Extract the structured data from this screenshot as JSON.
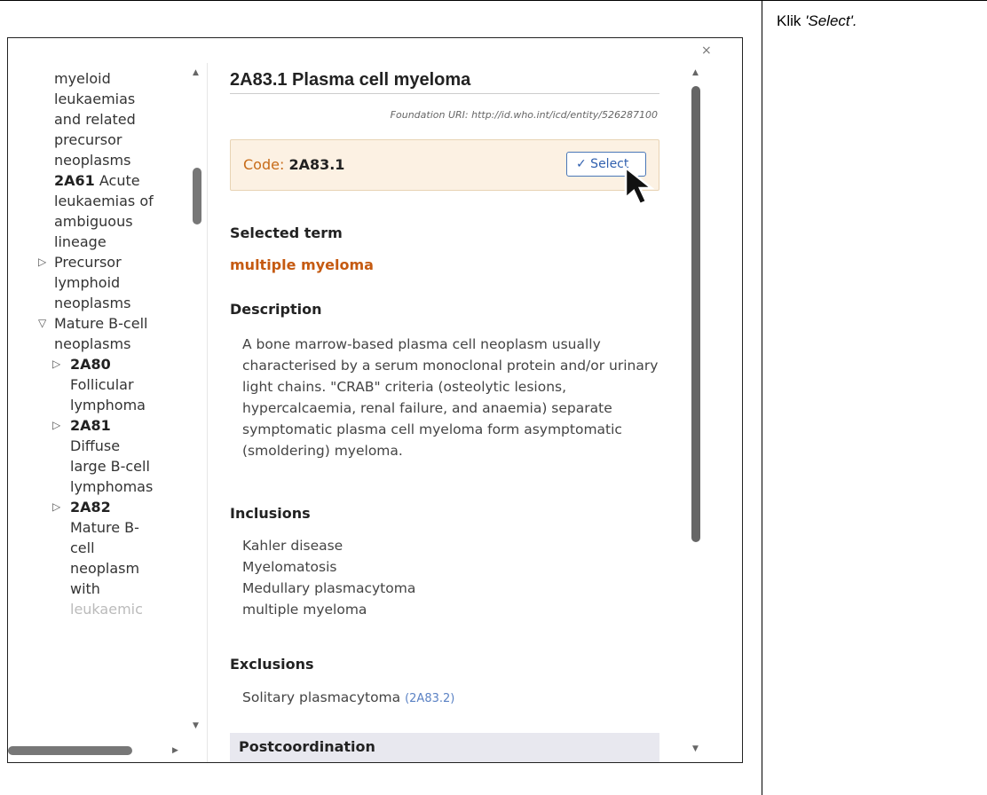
{
  "instruction": {
    "prefix": "Klik ",
    "emphasis": "'Select'."
  },
  "window": {
    "close_symbol": "×"
  },
  "tree": {
    "items": [
      {
        "text": "myeloid",
        "bold": false
      },
      {
        "text": "leukaemias",
        "bold": false
      },
      {
        "text": "and related",
        "bold": false
      },
      {
        "text": "precursor",
        "bold": false
      },
      {
        "text": "neoplasms",
        "bold": false
      }
    ],
    "acute_code": "2A61",
    "acute_lines": [
      "Acute",
      "leukaemias of",
      "ambiguous",
      "lineage"
    ],
    "precursor_lines": [
      "Precursor",
      "lymphoid",
      "neoplasms"
    ],
    "mature_lines": [
      "Mature B-cell",
      "neoplasms"
    ],
    "child_2a80_code": "2A80",
    "child_2a80_lines": [
      "Follicular",
      "lymphoma"
    ],
    "child_2a81_code": "2A81",
    "child_2a81_lines": [
      "Diffuse",
      "large B-cell",
      "lymphomas"
    ],
    "child_2a82_code": "2A82",
    "child_2a82_lines": [
      "Mature B-",
      "cell",
      "neoplasm",
      "with",
      "leukaemic"
    ],
    "collapsed_marker": "▷",
    "expanded_marker": "▽"
  },
  "entity": {
    "title": "2A83.1 Plasma cell myeloma",
    "foundation_uri": "Foundation URI: http://id.who.int/icd/entity/526287100",
    "code_label": "Code: ",
    "code_value": "2A83.1",
    "select_label": "✓ Select",
    "selected_term_heading": "Selected term",
    "selected_term": "multiple myeloma",
    "description_heading": "Description",
    "description": "A bone marrow-based plasma cell neoplasm usually characterised by a serum monoclonal protein and/or urinary light chains. \"CRAB\" criteria (osteolytic lesions, hypercalcaemia, renal failure, and anaemia) separate symptomatic plasma cell myeloma form asymptomatic (smoldering) myeloma.",
    "inclusions_heading": "Inclusions",
    "inclusions": [
      "Kahler disease",
      "Myelomatosis",
      "Medullary plasmacytoma",
      "multiple myeloma"
    ],
    "exclusions_heading": "Exclusions",
    "exclusion_text": "Solitary plasmacytoma",
    "exclusion_code": "(2A83.2)",
    "postcoordination_heading": "Postcoordination"
  },
  "colors": {
    "code_label": "#c76b18",
    "selected_term": "#c55a11",
    "select_button": "#2f5fae",
    "code_box_bg": "#fcf1e3"
  }
}
